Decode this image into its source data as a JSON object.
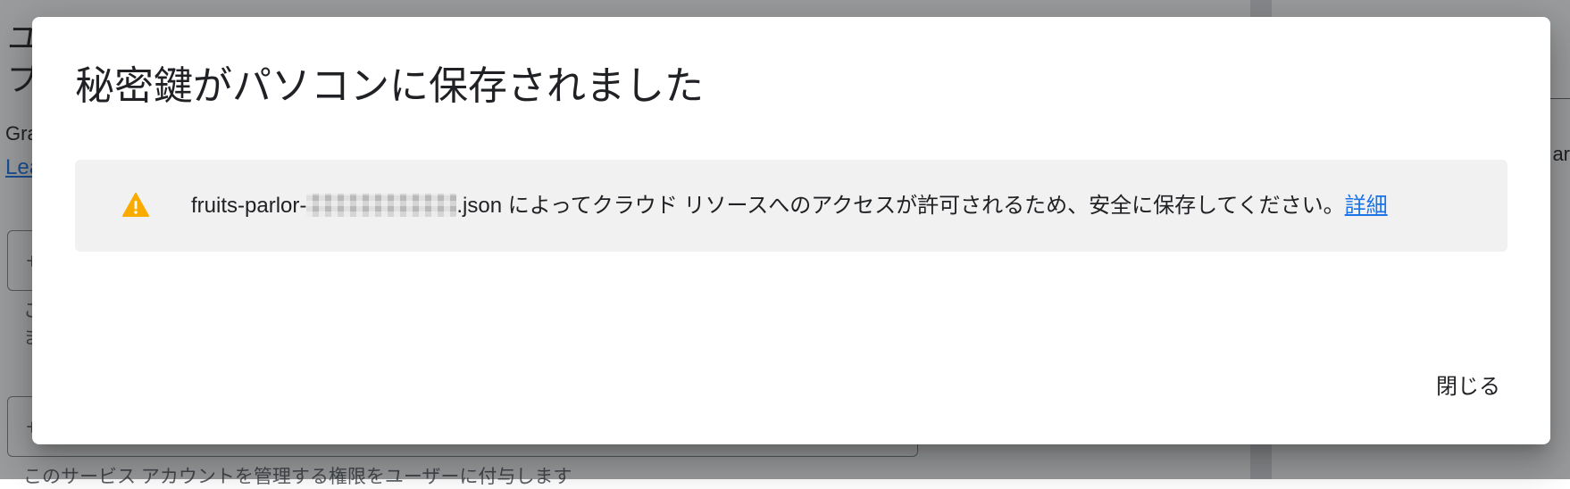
{
  "background": {
    "title": "ユ\nプ",
    "description": "Gra",
    "link": "Lea",
    "field1_text": "サ",
    "field1_helper": "こ\nま",
    "field2_text": "サ",
    "field2_helper": "このサービス アカウントを管理する権限をユーザーに付与します",
    "side_text": "ar"
  },
  "dialog": {
    "title": "秘密鍵がパソコンに保存されました",
    "notice": {
      "icon": "warning-icon",
      "filename_prefix": "fruits-parlor-",
      "filename_suffix": ".json",
      "message": " によってクラウド リソースへのアクセスが許可されるため、安全に保存してください。",
      "link_label": "詳細"
    },
    "close_label": "閉じる"
  },
  "colors": {
    "warning": "#f9ab00",
    "link": "#1a73e8",
    "notice_bg": "#f1f1f1"
  }
}
